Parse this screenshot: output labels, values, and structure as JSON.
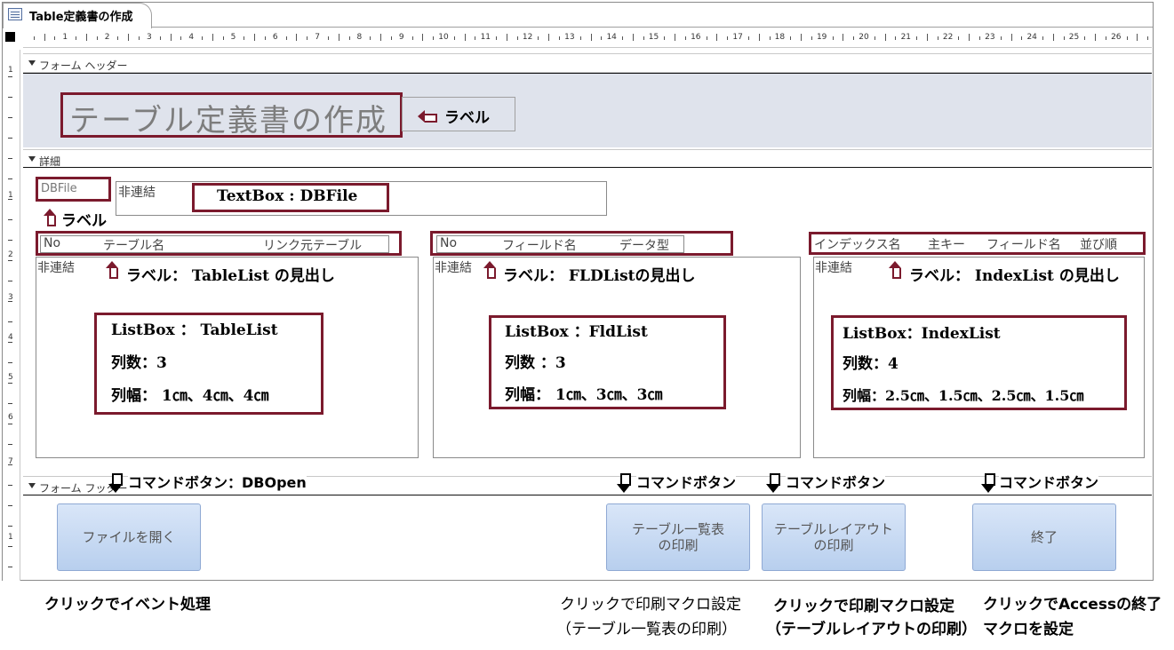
{
  "tab": {
    "title": "Table定義書の作成"
  },
  "ruler": {
    "numbers": [
      "1",
      "2",
      "3",
      "4",
      "5",
      "6",
      "7",
      "8",
      "9",
      "10",
      "11",
      "12",
      "13",
      "14",
      "15",
      "16",
      "17",
      "18",
      "19",
      "20",
      "21",
      "22",
      "23",
      "24",
      "25",
      "26"
    ],
    "vnumbers": [
      "1",
      "1",
      "2",
      "3",
      "4",
      "5",
      "6",
      "7",
      "1"
    ]
  },
  "sections": {
    "header": "フォーム ヘッダー",
    "detail": "詳細",
    "footer": "フォーム フッター"
  },
  "header": {
    "title_label": "テーブル定義書の作成",
    "note": "ラベル"
  },
  "detail": {
    "dbfile_label": "DBFile",
    "dbfile_box_text": "非連結",
    "dbfile_note": "TextBox : DBFile",
    "dbfile_label_note": "ラベル",
    "table_heading": {
      "col1": "No",
      "col2": "テーブル名",
      "col3": "リンク元テーブル"
    },
    "field_heading": {
      "col1": "No",
      "col2": "フィールド名",
      "col3": "データ型"
    },
    "index_heading": {
      "col1": "インデックス名",
      "col2": "主キー",
      "col3": "フィールド名",
      "col4": "並び順"
    },
    "unbound": "非連結",
    "table_note": "ラベル： TableList の見出し",
    "field_note": "ラベル： FLDListの見出し",
    "index_note": "ラベル： IndexList の見出し",
    "table_spec": {
      "line1": "ListBox ： TableList",
      "line2": "列数：3",
      "line3": "列幅： 1㎝、4㎝、4㎝"
    },
    "field_spec": {
      "line1": "ListBox ：FldList",
      "line2": "列数 ：3",
      "line3": "列幅： 1㎝、3㎝、3㎝"
    },
    "index_spec": {
      "line1": "ListBox：IndexList",
      "line2": "列数：4",
      "line3": "列幅：2.5㎝、1.5㎝、2.5㎝、1.5㎝"
    }
  },
  "footer": {
    "cmd_notes": [
      "コマンドボタン：DBOpen",
      "コマンドボタン",
      "コマンドボタン",
      "コマンドボタン"
    ],
    "buttons": [
      "ファイルを開く",
      "テーブル一覧表\nの印刷",
      "テーブルレイアウト\nの印刷",
      "終了"
    ]
  },
  "captions": {
    "c1": "クリックでイベント処理",
    "c2a": "クリックで印刷マクロ設定",
    "c2b": "（テーブル一覧表の印刷）",
    "c3a": "クリックで印刷マクロ設定",
    "c3b": "（テーブルレイアウトの印刷）",
    "c4a": "クリックでAccessの終了",
    "c4b": "マクロを設定"
  },
  "colors": {
    "annotation": "#7b1a2d",
    "header_bg": "#dfe3ec",
    "button": "#c6d8f2"
  },
  "icons": [
    "form-icon",
    "section-collapse-icon",
    "arrow-up-icon",
    "arrow-down-icon",
    "arrow-left-icon"
  ]
}
